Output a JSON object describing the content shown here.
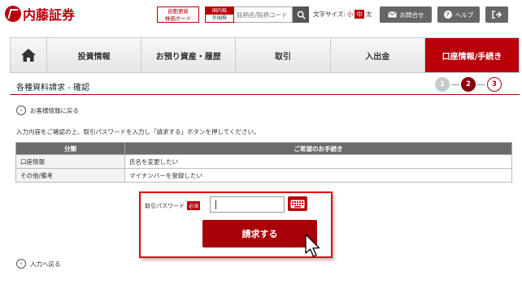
{
  "header": {
    "logo_text": "内藤証券",
    "auto_update_line1": "自動更新",
    "auto_update_line2": "株価ボード",
    "market_domestic": "国内株",
    "market_foreign": "外国株",
    "search_placeholder": "銘柄名/銘柄コード",
    "font_size_label": "文字サイズ:",
    "font_small": "小",
    "font_mid": "中",
    "font_large": "太",
    "contact_label": "お問合せ",
    "help_label": "ヘルプ"
  },
  "nav": {
    "items": [
      {
        "label": "投資情報"
      },
      {
        "label": "お預り資産・履歴"
      },
      {
        "label": "取引"
      },
      {
        "label": "入出金"
      },
      {
        "label": "口座情報/手続き"
      }
    ],
    "active_index": 4
  },
  "page": {
    "title": "各種資料請求 - 確認",
    "steps": [
      "1",
      "2",
      "3"
    ],
    "current_step": 2,
    "back_to_customer_info": "お客様情報に戻る",
    "instruction": "入力内容をご確認の上、取引パスワードを入力し「請求する」ボタンを押してください。"
  },
  "table": {
    "headers": [
      "分類",
      "ご希望のお手続き"
    ],
    "rows": [
      [
        "口座情報",
        "氏名を変更したい"
      ],
      [
        "その他/備考",
        "マイナンバーを登録したい"
      ]
    ]
  },
  "form": {
    "password_label": "取引パスワード",
    "required_badge": "必須",
    "password_value": "",
    "submit_label": "請求する"
  },
  "footer": {
    "back_to_input": "入力へ戻る"
  },
  "colors": {
    "brand": "#b9000a",
    "header_button": "#666666",
    "highlight_border": "#e00010"
  }
}
